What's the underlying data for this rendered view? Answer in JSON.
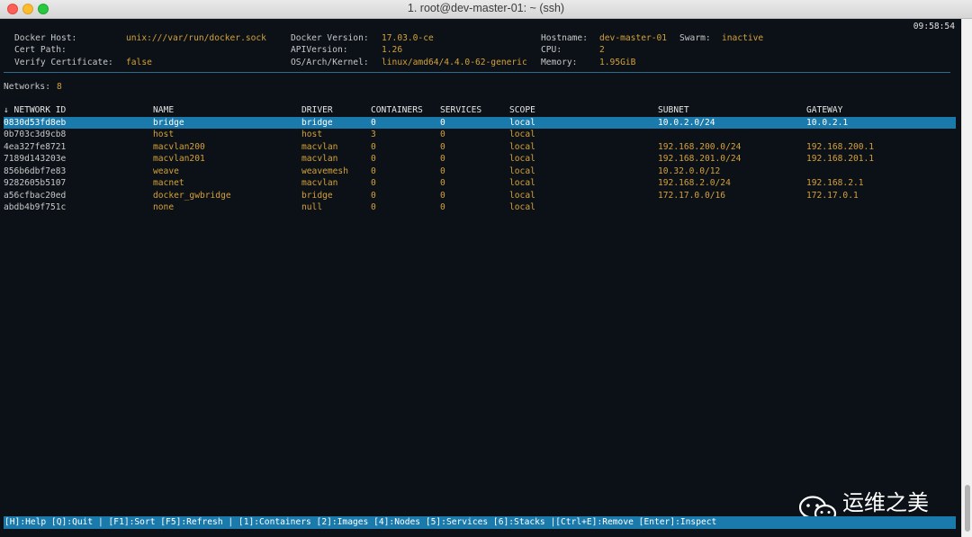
{
  "window": {
    "title": "1. root@dev-master-01: ~ (ssh)"
  },
  "clock": "09:58:54",
  "info": {
    "docker_host": {
      "label": "Docker Host:",
      "value": "unix:///var/run/docker.sock"
    },
    "cert_path": {
      "label": "Cert Path:",
      "value": ""
    },
    "verify_cert": {
      "label": "Verify Certificate:",
      "value": "false"
    },
    "docker_version": {
      "label": "Docker Version:",
      "value": "17.03.0-ce"
    },
    "api_version": {
      "label": "APIVersion:",
      "value": "1.26"
    },
    "os_arch": {
      "label": "OS/Arch/Kernel:",
      "value": "linux/amd64/4.4.0-62-generic"
    },
    "hostname": {
      "label": "Hostname:",
      "value": "dev-master-01"
    },
    "swarm": {
      "label": "Swarm:",
      "value": "inactive"
    },
    "cpu": {
      "label": "CPU:",
      "value": "2"
    },
    "memory": {
      "label": "Memory:",
      "value": "1.95GiB"
    }
  },
  "networks": {
    "label": "Networks:",
    "count": "8"
  },
  "table": {
    "headers": [
      "↓ NETWORK ID",
      "NAME",
      "DRIVER",
      "CONTAINERS",
      "SERVICES",
      "SCOPE",
      "SUBNET",
      "GATEWAY"
    ],
    "rows": [
      {
        "id": "0830d53fd8eb",
        "name": "bridge",
        "driver": "bridge",
        "containers": "0",
        "services": "0",
        "scope": "local",
        "subnet": "10.0.2.0/24",
        "gateway": "10.0.2.1"
      },
      {
        "id": "0b703c3d9cb8",
        "name": "host",
        "driver": "host",
        "containers": "3",
        "services": "0",
        "scope": "local",
        "subnet": "",
        "gateway": ""
      },
      {
        "id": "4ea327fe8721",
        "name": "macvlan200",
        "driver": "macvlan",
        "containers": "0",
        "services": "0",
        "scope": "local",
        "subnet": "192.168.200.0/24",
        "gateway": "192.168.200.1"
      },
      {
        "id": "7189d143203e",
        "name": "macvlan201",
        "driver": "macvlan",
        "containers": "0",
        "services": "0",
        "scope": "local",
        "subnet": "192.168.201.0/24",
        "gateway": "192.168.201.1"
      },
      {
        "id": "856b6dbf7e83",
        "name": "weave",
        "driver": "weavemesh",
        "containers": "0",
        "services": "0",
        "scope": "local",
        "subnet": "10.32.0.0/12",
        "gateway": ""
      },
      {
        "id": "9282605b5107",
        "name": "macnet",
        "driver": "macvlan",
        "containers": "0",
        "services": "0",
        "scope": "local",
        "subnet": "192.168.2.0/24",
        "gateway": "192.168.2.1"
      },
      {
        "id": "a56cfbac20ed",
        "name": "docker_gwbridge",
        "driver": "bridge",
        "containers": "0",
        "services": "0",
        "scope": "local",
        "subnet": "172.17.0.0/16",
        "gateway": "172.17.0.1"
      },
      {
        "id": "abdb4b9f751c",
        "name": "none",
        "driver": "null",
        "containers": "0",
        "services": "0",
        "scope": "local",
        "subnet": "",
        "gateway": ""
      }
    ]
  },
  "footer": "[H]:Help [Q]:Quit | [F1]:Sort [F5]:Refresh | [1]:Containers [2]:Images [4]:Nodes [5]:Services [6]:Stacks |[Ctrl+E]:Remove [Enter]:Inspect",
  "watermark": {
    "text": "运维之美",
    "icon": "wechat-icon"
  },
  "colors": {
    "terminal_bg": "#0c1117",
    "value": "#d3a13a",
    "selection": "#1a7aab"
  }
}
